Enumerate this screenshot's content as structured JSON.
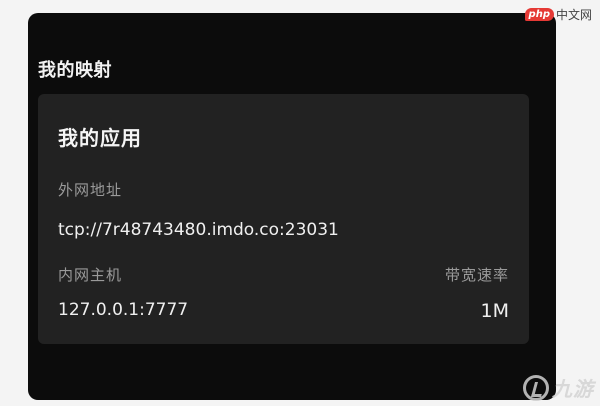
{
  "panel": {
    "title": "我的映射"
  },
  "card": {
    "title": "我的应用",
    "external_address_label": "外网地址",
    "external_address_value": "tcp://7r48743480.imdo.co:23031",
    "internal_host_label": "内网主机",
    "internal_host_value": "127.0.0.1:7777",
    "bandwidth_label": "带宽速率",
    "bandwidth_value": "1M"
  },
  "watermarks": {
    "php": {
      "mark": "php",
      "text": "中文网"
    },
    "nine_you": {
      "text": "九游"
    }
  },
  "colors": {
    "panel_background": "#0c0c0c",
    "card_background": "#222222",
    "label_color": "#9a9a9a",
    "value_color": "#f0f0f0",
    "php_brand": "#e53935"
  }
}
